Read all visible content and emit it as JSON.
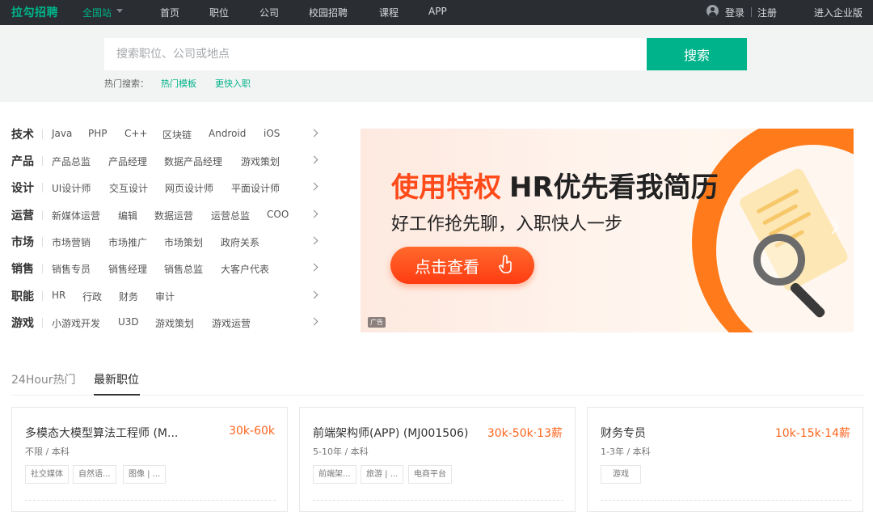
{
  "header": {
    "logo": "拉勾招聘",
    "city": "全国站",
    "nav": [
      "首页",
      "职位",
      "公司",
      "校园招聘",
      "课程",
      "APP"
    ],
    "login": "登录",
    "register": "注册",
    "enterprise": "进入企业版"
  },
  "search": {
    "placeholder": "搜索职位、公司或地点",
    "button": "搜索",
    "hot_label": "热门搜索：",
    "hot_links": [
      "热门模板",
      "更快入职"
    ]
  },
  "categories": [
    {
      "title": "技术",
      "tags": [
        "Java",
        "PHP",
        "C++",
        "区块链",
        "Android",
        "iOS"
      ]
    },
    {
      "title": "产品",
      "tags": [
        "产品总监",
        "产品经理",
        "数据产品经理",
        "游戏策划"
      ]
    },
    {
      "title": "设计",
      "tags": [
        "UI设计师",
        "交互设计",
        "网页设计师",
        "平面设计师"
      ]
    },
    {
      "title": "运营",
      "tags": [
        "新媒体运营",
        "编辑",
        "数据运营",
        "运营总监",
        "COO"
      ]
    },
    {
      "title": "市场",
      "tags": [
        "市场营销",
        "市场推广",
        "市场策划",
        "政府关系"
      ]
    },
    {
      "title": "销售",
      "tags": [
        "销售专员",
        "销售经理",
        "销售总监",
        "大客户代表"
      ]
    },
    {
      "title": "职能",
      "tags": [
        "HR",
        "行政",
        "财务",
        "审计"
      ]
    },
    {
      "title": "游戏",
      "tags": [
        "小游戏开发",
        "U3D",
        "游戏策划",
        "游戏运营"
      ]
    }
  ],
  "banner": {
    "headline_highlight": "使用特权",
    "headline_rest": "HR优先看我简历",
    "subline": "好工作抢先聊，入职快人一步",
    "cta": "点击查看",
    "ad_badge": "广告"
  },
  "tabs": [
    "24Hour热门",
    "最新职位"
  ],
  "jobs": [
    {
      "title": "多模态大模型算法工程师 (M...",
      "salary": "30k-60k",
      "requirements": "不限 / 本科",
      "tags": [
        "社交媒体",
        "自然语...",
        "图像 | ..."
      ]
    },
    {
      "title": "前端架构师(APP) (MJ001506)",
      "salary": "30k-50k·13薪",
      "requirements": "5-10年 / 本科",
      "tags": [
        "前端架...",
        "旅游 | ...",
        "电商平台"
      ]
    },
    {
      "title": "财务专员",
      "salary": "10k-15k·14薪",
      "requirements": "1-3年 / 本科",
      "tags": [
        "游戏"
      ]
    }
  ],
  "colors": {
    "brand": "#00b38a",
    "salary": "#fd661f",
    "topbar": "#2a2d32",
    "banner_accent": "#ff4a1a"
  }
}
